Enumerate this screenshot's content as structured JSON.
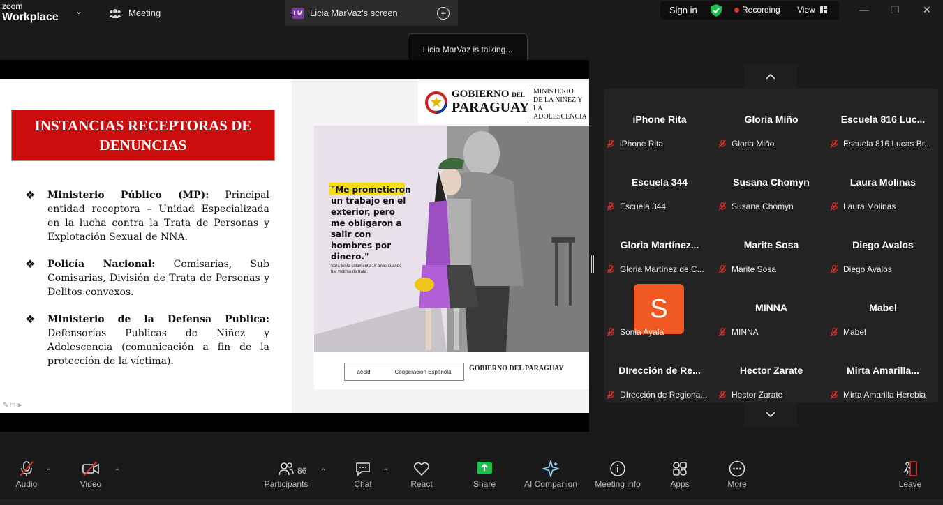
{
  "topbar": {
    "brand_small": "zoom",
    "brand_large": "Workplace",
    "meeting_tab": "Meeting",
    "share_tab_badge": "LM",
    "share_tab_label": "Licia MarVaz's screen",
    "sign_in": "Sign in",
    "recording": "Recording",
    "view": "View"
  },
  "talking_toast": "Licia MarVaz is talking...",
  "slide": {
    "title": "INSTANCIAS RECEPTORAS DE DENUNCIAS",
    "bullets": [
      {
        "bold": "Ministerio Público (MP):",
        "text": " Principal entidad receptora – Unidad Especializada en la lucha contra la Trata de Personas y Explotación Sexual de NNA."
      },
      {
        "bold": "Policía Nacional:",
        "text": " Comisarias, Sub Comisarias, División de Trata de Personas y Delitos convexos."
      },
      {
        "bold": "Ministerio de la Defensa Publica:",
        "text": " Defensorías Publicas de Niñez y Adolescencia (comunicación a fin de la protección de la víctima)."
      }
    ],
    "logo_line1": "GOBIERNO",
    "logo_del": "DEL",
    "logo_line2": "PARAGUAY",
    "logo_ministry": "MINISTERIO DE LA NIÑEZ Y LA ADOLESCENCIA",
    "poster_quote": "\"Me prometieron un trabajo en el exterior, pero me obligaron a salir con hombres por dinero.\"",
    "poster_caption": "Sara tenía solamente 16 años cuando fue víctima de trata.",
    "footer_logos": [
      "aecid",
      "Cooperación Española"
    ],
    "footer_gov": "GOBIERNO DEL PARAGUAY"
  },
  "participants": [
    {
      "name": "iPhone Rita",
      "label": "iPhone Rita"
    },
    {
      "name": "Gloria Miño",
      "label": "Gloria Miño"
    },
    {
      "name": "Escuela 816 Luc...",
      "label": "Escuela 816 Lucas Br..."
    },
    {
      "name": "Escuela 344",
      "label": "Escuela 344"
    },
    {
      "name": "Susana Chomyn",
      "label": "Susana Chomyn"
    },
    {
      "name": "Laura Molinas",
      "label": "Laura Molinas"
    },
    {
      "name": "Gloria  Martínez...",
      "label": "Gloria Martínez de C..."
    },
    {
      "name": "Marite Sosa",
      "label": "Marite Sosa"
    },
    {
      "name": "Diego Avalos",
      "label": "Diego Avalos"
    },
    {
      "name": "",
      "label": "Sonia Ayala",
      "avatar": "S"
    },
    {
      "name": "MINNA",
      "label": "MINNA"
    },
    {
      "name": "Mabel",
      "label": "Mabel"
    },
    {
      "name": "DIrección  de  Re...",
      "label": "DIrección de Regiona..."
    },
    {
      "name": "Hector Zarate",
      "label": "Hector Zarate"
    },
    {
      "name": "Mirta  Amarilla...",
      "label": "Mirta Amarilla Herebia"
    }
  ],
  "toolbar": {
    "audio": "Audio",
    "video": "Video",
    "participants": "Participants",
    "participant_count": "86",
    "chat": "Chat",
    "react": "React",
    "share": "Share",
    "ai": "AI Companion",
    "info": "Meeting info",
    "apps": "Apps",
    "more": "More",
    "leave": "Leave"
  },
  "colors": {
    "accent_green": "#1fbf4f",
    "record_red": "#e0312b",
    "avatar_orange": "#f05a22",
    "title_red": "#cc0d0d"
  }
}
